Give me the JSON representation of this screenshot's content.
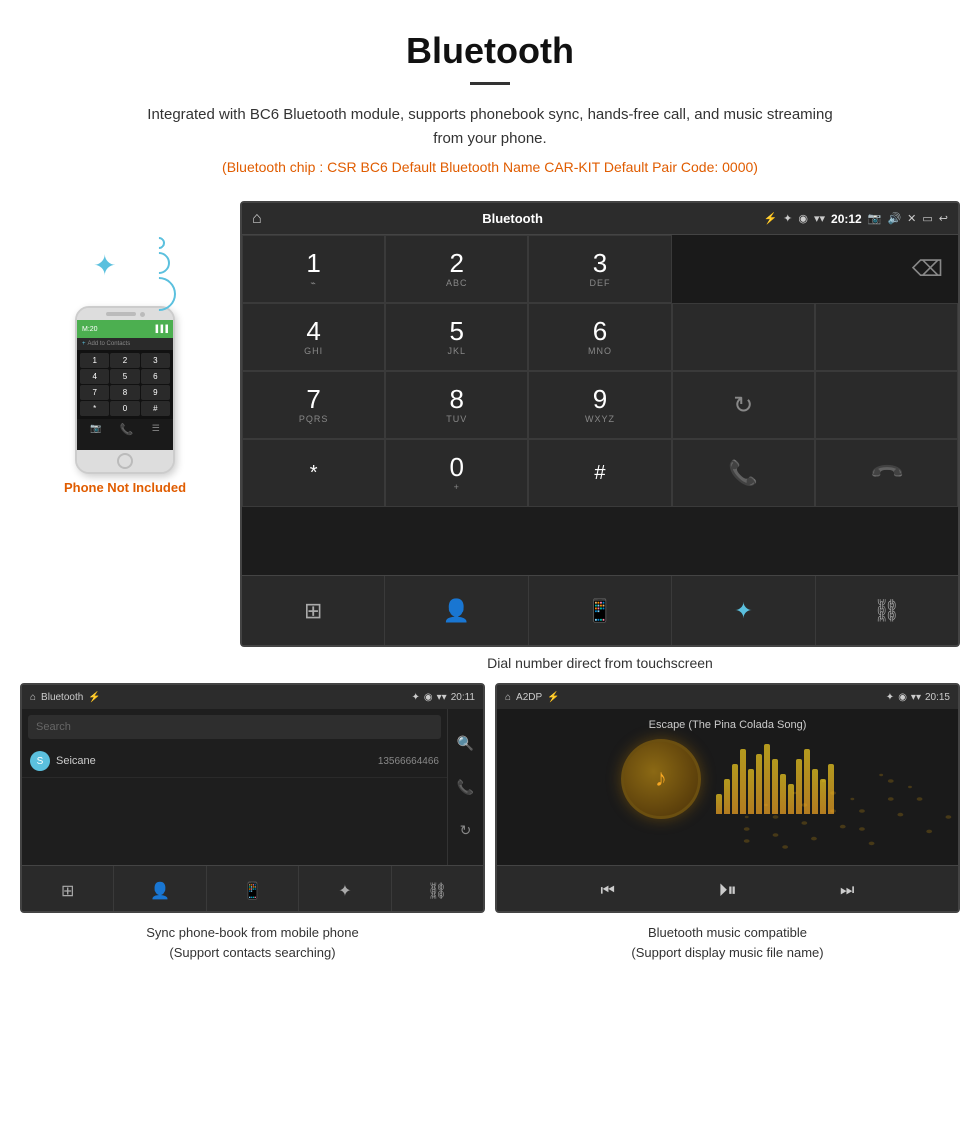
{
  "header": {
    "title": "Bluetooth",
    "description": "Integrated with BC6 Bluetooth module, supports phonebook sync, hands-free call, and music streaming from your phone.",
    "specs": "(Bluetooth chip : CSR BC6    Default Bluetooth Name CAR-KIT    Default Pair Code: 0000)"
  },
  "car_screen": {
    "status_bar": {
      "title": "Bluetooth",
      "time": "20:12",
      "icons": [
        "home",
        "bluetooth",
        "usb",
        "location",
        "signal",
        "volume",
        "close",
        "screen",
        "back"
      ]
    },
    "dialpad": {
      "keys": [
        {
          "digit": "1",
          "sub": "⌁"
        },
        {
          "digit": "2",
          "sub": "ABC"
        },
        {
          "digit": "3",
          "sub": "DEF"
        },
        {
          "digit": "4",
          "sub": "GHI"
        },
        {
          "digit": "5",
          "sub": "JKL"
        },
        {
          "digit": "6",
          "sub": "MNO"
        },
        {
          "digit": "7",
          "sub": "PQRS"
        },
        {
          "digit": "8",
          "sub": "TUV"
        },
        {
          "digit": "9",
          "sub": "WXYZ"
        },
        {
          "digit": "*",
          "sub": ""
        },
        {
          "digit": "0",
          "sub": "+"
        },
        {
          "digit": "#",
          "sub": ""
        }
      ]
    },
    "bottom_nav": [
      "dialpad",
      "contacts",
      "phone",
      "bluetooth",
      "link"
    ]
  },
  "dial_caption": "Dial number direct from touchscreen",
  "phone_label": "Phone Not Included",
  "phonebook_screen": {
    "status_bar_title": "Bluetooth",
    "time": "20:11",
    "search_placeholder": "Search",
    "contacts": [
      {
        "initial": "S",
        "name": "Seicane",
        "number": "13566664466"
      }
    ],
    "nav": [
      "dialpad",
      "person",
      "phone",
      "bluetooth",
      "link"
    ]
  },
  "music_screen": {
    "status_bar_title": "A2DP",
    "time": "20:15",
    "song_title": "Escape (The Pina Colada Song)",
    "equalizer_bars": [
      20,
      35,
      50,
      65,
      45,
      60,
      70,
      55,
      40,
      30,
      55,
      65,
      45,
      35,
      50
    ],
    "controls": [
      "prev",
      "play-pause",
      "next"
    ]
  },
  "phonebook_caption": "Sync phone-book from mobile phone\n(Support contacts searching)",
  "music_caption": "Bluetooth music compatible\n(Support display music file name)"
}
